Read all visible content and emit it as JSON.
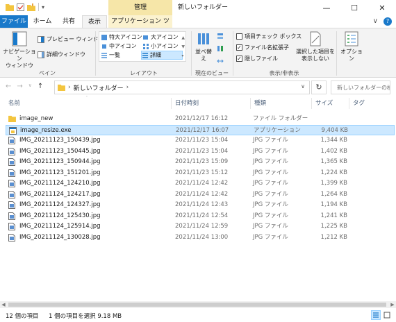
{
  "titlebar": {
    "manage_tab": "管理",
    "window_title": "新しいフォルダー",
    "minimize": "—",
    "maximize": "☐",
    "close": "✕"
  },
  "tabs": {
    "file": "ファイル",
    "home": "ホーム",
    "share": "共有",
    "view": "表示",
    "app_tools": "アプリケーション ツール",
    "collapse": "∨",
    "help": "?"
  },
  "ribbon": {
    "pane_group": {
      "nav_pane": "ナビゲーション\nウィンドウ",
      "preview_pane": "プレビュー ウィンドウ",
      "details_pane": "詳細ウィンドウ",
      "label": "ペイン"
    },
    "layout_group": {
      "xl_icons": "特大アイコン",
      "large_icons": "大アイコン",
      "medium_icons": "中アイコン",
      "small_icons": "小アイコン",
      "list": "一覧",
      "details": "詳細",
      "label": "レイアウト"
    },
    "current_view_group": {
      "sort_by": "並べ替え",
      "label": "現在のビュー"
    },
    "show_hide_group": {
      "item_checkboxes": "項目チェック ボックス",
      "item_checkboxes_checked": false,
      "file_extensions": "ファイル名拡張子",
      "file_extensions_checked": true,
      "hidden_items": "隠しファイル",
      "hidden_items_checked": true,
      "hide_selected": "選択した項目を\n表示しない",
      "label": "表示/非表示"
    },
    "options": "オプション"
  },
  "address": {
    "path": "新しいフォルダー",
    "search_placeholder": "新しいフォルダーの検索"
  },
  "columns": {
    "name": "名前",
    "date": "日付時刻",
    "type": "種類",
    "size": "サイズ",
    "tag": "タグ"
  },
  "files": [
    {
      "name": "image_new",
      "date": "2021/12/17 16:12",
      "type": "ファイル フォルダー",
      "size": "",
      "icon": "folder-icon",
      "selected": false
    },
    {
      "name": "image_resize.exe",
      "date": "2021/12/17 16:07",
      "type": "アプリケーション",
      "size": "9,404 KB",
      "icon": "exe-icon",
      "selected": true
    },
    {
      "name": "IMG_20211123_150439.jpg",
      "date": "2021/11/23 15:04",
      "type": "JPG ファイル",
      "size": "1,344 KB",
      "icon": "image-file-icon",
      "selected": false
    },
    {
      "name": "IMG_20211123_150445.jpg",
      "date": "2021/11/23 15:04",
      "type": "JPG ファイル",
      "size": "1,402 KB",
      "icon": "image-file-icon",
      "selected": false
    },
    {
      "name": "IMG_20211123_150944.jpg",
      "date": "2021/11/23 15:09",
      "type": "JPG ファイル",
      "size": "1,365 KB",
      "icon": "image-file-icon",
      "selected": false
    },
    {
      "name": "IMG_20211123_151201.jpg",
      "date": "2021/11/23 15:12",
      "type": "JPG ファイル",
      "size": "1,224 KB",
      "icon": "image-file-icon",
      "selected": false
    },
    {
      "name": "IMG_20211124_124210.jpg",
      "date": "2021/11/24 12:42",
      "type": "JPG ファイル",
      "size": "1,399 KB",
      "icon": "image-file-icon",
      "selected": false
    },
    {
      "name": "IMG_20211124_124217.jpg",
      "date": "2021/11/24 12:42",
      "type": "JPG ファイル",
      "size": "1,264 KB",
      "icon": "image-file-icon",
      "selected": false
    },
    {
      "name": "IMG_20211124_124327.jpg",
      "date": "2021/11/24 12:43",
      "type": "JPG ファイル",
      "size": "1,194 KB",
      "icon": "image-file-icon",
      "selected": false
    },
    {
      "name": "IMG_20211124_125430.jpg",
      "date": "2021/11/24 12:54",
      "type": "JPG ファイル",
      "size": "1,241 KB",
      "icon": "image-file-icon",
      "selected": false
    },
    {
      "name": "IMG_20211124_125914.jpg",
      "date": "2021/11/24 12:59",
      "type": "JPG ファイル",
      "size": "1,225 KB",
      "icon": "image-file-icon",
      "selected": false
    },
    {
      "name": "IMG_20211124_130028.jpg",
      "date": "2021/11/24 13:00",
      "type": "JPG ファイル",
      "size": "1,212 KB",
      "icon": "image-file-icon",
      "selected": false
    }
  ],
  "status": {
    "item_count": "12 個の項目",
    "selection": "1 個の項目を選択  9.18 MB"
  },
  "colors": {
    "accent": "#1979ca",
    "selection_bg": "#cce8ff",
    "selection_border": "#99d1ff",
    "manage_tab": "#f6e6a8",
    "folder": "#f3c53f"
  }
}
